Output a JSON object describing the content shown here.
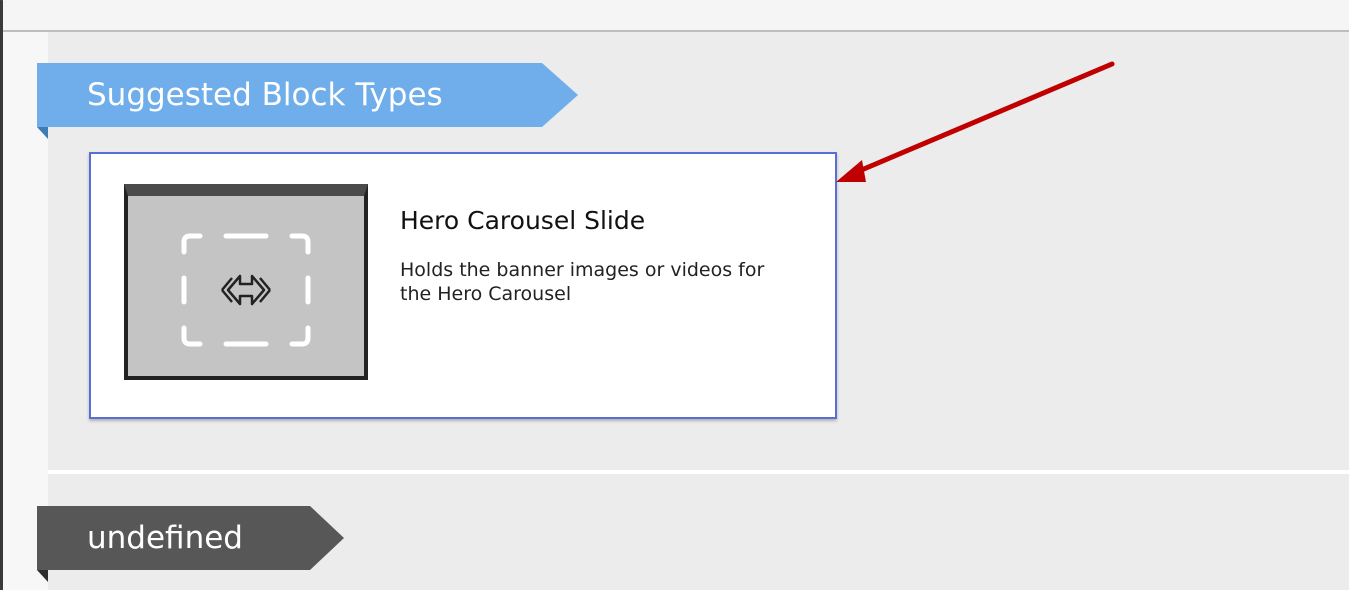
{
  "section": {
    "title": "Suggested Block Types"
  },
  "block_card": {
    "title": "Hero Carousel Slide",
    "description": "Holds the banner images or videos for the Hero Carousel",
    "icon": "carousel-placeholder-icon"
  },
  "second_section": {
    "title": "undefined"
  },
  "colors": {
    "ribbon_blue": "#6faeea",
    "ribbon_dark": "#575757",
    "card_border": "#5a6fd6",
    "annotation_arrow": "#c00000"
  }
}
